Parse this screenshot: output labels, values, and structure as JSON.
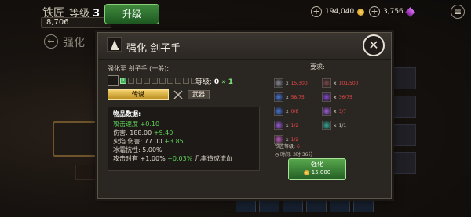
{
  "header": {
    "title": "铁匠",
    "level_label": "等级",
    "level_value": "3",
    "xp_value": "8,706",
    "upgrade_button": "升级",
    "gold": "194,040",
    "gems": "3,756",
    "plus": "+",
    "back_title": "强化"
  },
  "modal": {
    "title": "强化 刽子手",
    "close_symbol": "✕",
    "target_label": "强化至 刽子手 (一般):",
    "first_slot_label": "1",
    "level_text": "等级:",
    "level_current": "0",
    "level_arrow": "»",
    "level_next": "1",
    "rarity": "传说",
    "category": "武器",
    "stats": {
      "title": "物品数据:",
      "lines": [
        {
          "segments": [
            {
              "text": "攻击速度 +0.10",
              "green": true
            }
          ]
        },
        {
          "segments": [
            {
              "text": "伤害: 188.00 ",
              "green": false
            },
            {
              "text": "+9.40",
              "green": true
            }
          ]
        },
        {
          "segments": [
            {
              "text": "火焰 伤害: 77.00 ",
              "green": false
            },
            {
              "text": "+3.85",
              "green": true
            }
          ]
        },
        {
          "segments": [
            {
              "text": "冰霜抗性: 5.00%",
              "green": false
            }
          ]
        },
        {
          "segments": [
            {
              "text": "攻击时有 ",
              "green": false
            },
            {
              "text": "+1.00%",
              "green": false
            },
            {
              "text": " +0.03%",
              "green": true
            },
            {
              "text": " 几率造成流血",
              "green": false
            }
          ]
        }
      ]
    },
    "requirements": {
      "title": "要求:",
      "left": [
        {
          "icon": "ore-icon",
          "have": "15",
          "need": "300",
          "ok": false
        },
        {
          "icon": "crystal-blue-icon",
          "have": "58",
          "need": "75",
          "ok": false
        },
        {
          "icon": "crystal-blue-icon",
          "have": "0",
          "need": "8",
          "ok": false
        },
        {
          "icon": "shard-purple-icon",
          "have": "1",
          "need": "2",
          "ok": false
        },
        {
          "icon": "feather-icon",
          "have": "1",
          "need": "2",
          "ok": false
        }
      ],
      "right": [
        {
          "icon": "ore-dark-icon",
          "have": "101",
          "need": "500",
          "ok": false
        },
        {
          "icon": "crystal-purple-icon",
          "have": "36",
          "need": "75",
          "ok": false
        },
        {
          "icon": "shard-purple-icon",
          "have": "3",
          "need": "7",
          "ok": false
        },
        {
          "icon": "gem-green-icon",
          "have": "1",
          "need": "1",
          "ok": true
        }
      ],
      "smith_level_label": "铁匠等级:",
      "smith_level_value": "6",
      "time_label": "时间:",
      "time_value": "3时 36分"
    },
    "forge_button": "强化",
    "forge_cost": "15,000"
  }
}
